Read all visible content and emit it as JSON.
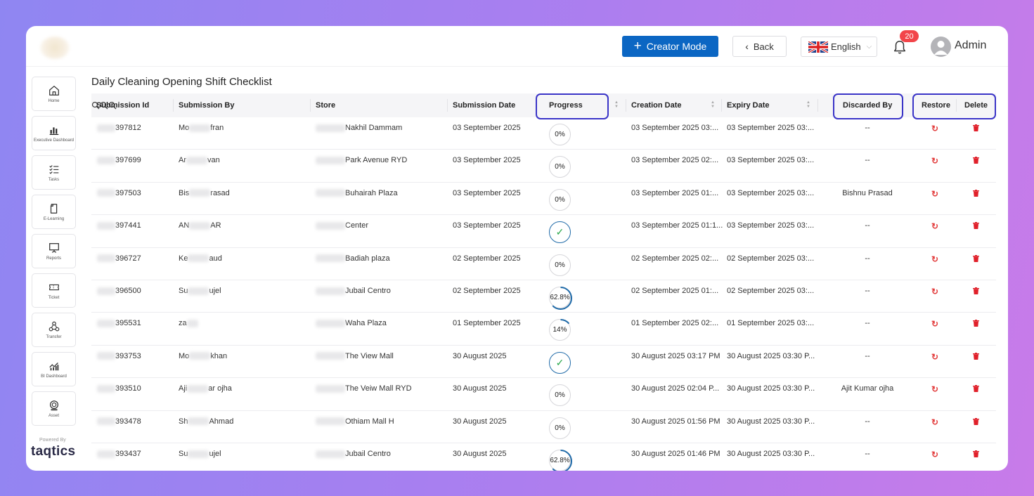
{
  "topbar": {
    "creator_label": "Creator Mode",
    "back_label": "Back",
    "language": "English",
    "notifications": "20",
    "user": "Admin"
  },
  "sidebar": {
    "items": [
      {
        "label": "Home",
        "icon": "home-icon"
      },
      {
        "label": "Executive Dashboard",
        "icon": "bar-chart-icon"
      },
      {
        "label": "Tasks",
        "icon": "checklist-icon"
      },
      {
        "label": "E-Learning",
        "icon": "document-icon"
      },
      {
        "label": "Reports",
        "icon": "presentation-icon"
      },
      {
        "label": "Ticket",
        "icon": "ticket-icon"
      },
      {
        "label": "Transfer",
        "icon": "transfer-icon"
      },
      {
        "label": "BI Dashboard",
        "icon": "analytics-icon"
      },
      {
        "label": "Asset",
        "icon": "asset-icon"
      }
    ],
    "powered_by": "Powered By",
    "brand": "taqtics"
  },
  "page": {
    "title": "Daily Cleaning Opening Shift Checklist"
  },
  "table": {
    "headers": [
      "Submission Id",
      "Submission By",
      "Store",
      "Submission Date",
      "Progress",
      "Creation Date",
      "Expiry Date",
      "Discarded By",
      "Restore",
      "Delete"
    ],
    "rows": [
      {
        "id": "397812",
        "by_a": "Mo",
        "by_b": "fran",
        "store": "Nakhil Dammam",
        "sub_date": "03 September 2025",
        "progress": "0%",
        "progress_value": 0,
        "created": "03 September 2025 03:...",
        "expiry": "03 September 2025 03:...",
        "discarded": "--"
      },
      {
        "id": "397699",
        "by_a": "Ar",
        "by_b": "van",
        "store": "Park Avenue RYD",
        "sub_date": "03 September 2025",
        "progress": "0%",
        "progress_value": 0,
        "created": "03 September 2025 02:...",
        "expiry": "03 September 2025 03:...",
        "discarded": "--"
      },
      {
        "id": "397503",
        "by_a": "Bis",
        "by_b": "rasad",
        "store": "Buhairah Plaza",
        "sub_date": "03 September 2025",
        "progress": "0%",
        "progress_value": 0,
        "created": "03 September 2025 01:...",
        "expiry": "03 September 2025 03:...",
        "discarded": "Bishnu Prasad"
      },
      {
        "id": "397441",
        "by_a": "AN",
        "by_b": "AR",
        "store": "Center",
        "sub_date": "03 September 2025",
        "progress": "✓",
        "progress_value": 100,
        "created": "03 September 2025 01:1...",
        "expiry": "03 September 2025 03:...",
        "discarded": "--"
      },
      {
        "id": "396727",
        "by_a": "Ke",
        "by_b": "aud",
        "store": "Badiah plaza",
        "sub_date": "02 September 2025",
        "progress": "0%",
        "progress_value": 0,
        "created": "02 September 2025 02:...",
        "expiry": "02 September 2025 03:...",
        "discarded": "--"
      },
      {
        "id": "396500",
        "by_a": "Su",
        "by_b": "ujel",
        "store": "Jubail Centro",
        "sub_date": "02 September 2025",
        "progress": "62.8%",
        "progress_value": 62.8,
        "created": "02 September 2025 01:...",
        "expiry": "02 September 2025 03:...",
        "discarded": "--"
      },
      {
        "id": "395531",
        "by_a": "za",
        "by_b": "",
        "store": "Waha Plaza",
        "sub_date": "01 September 2025",
        "progress": "14%",
        "progress_value": 14,
        "created": "01 September 2025 02:...",
        "expiry": "01 September 2025 03:...",
        "discarded": "--"
      },
      {
        "id": "393753",
        "by_a": "Mo",
        "by_b": "khan",
        "store": "The View Mall",
        "sub_date": "30 August 2025",
        "progress": "✓",
        "progress_value": 100,
        "created": "30 August 2025 03:17 PM",
        "expiry": "30 August 2025 03:30 P...",
        "discarded": "--"
      },
      {
        "id": "393510",
        "by_a": "Aji",
        "by_b": "ar ojha",
        "store": "The Veiw Mall RYD",
        "sub_date": "30 August 2025",
        "progress": "0%",
        "progress_value": 0,
        "created": "30 August 2025 02:04 P...",
        "expiry": "30 August 2025 03:30 P...",
        "discarded": "Ajit Kumar ojha"
      },
      {
        "id": "393478",
        "by_a": "Sh",
        "by_b": "Ahmad",
        "store": "Othiam Mall H",
        "sub_date": "30 August 2025",
        "progress": "0%",
        "progress_value": 0,
        "created": "30 August 2025 01:56 PM",
        "expiry": "30 August 2025 03:30 P...",
        "discarded": "--"
      },
      {
        "id": "393437",
        "by_a": "Su",
        "by_b": "ujel",
        "store": "Jubail Centro",
        "sub_date": "30 August 2025",
        "progress": "62.8%",
        "progress_value": 62.8,
        "created": "30 August 2025 01:46 PM",
        "expiry": "30 August 2025 03:30 P...",
        "discarded": "--"
      }
    ]
  },
  "colors": {
    "accent": "#0b66c3",
    "highlight": "#3a34c7",
    "danger": "#e23b3b",
    "done": "#2aa84a"
  }
}
